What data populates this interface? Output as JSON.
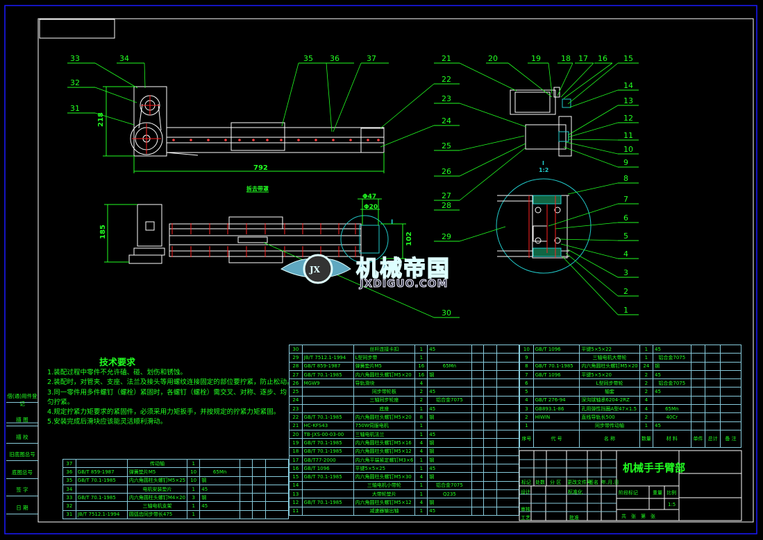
{
  "drawing_title": "机械手手臂部",
  "watermark": {
    "cn": "机械帝国",
    "en": "JXDIGUO.COM",
    "badge": "JX"
  },
  "view_label": "拆去带罩",
  "detail_label": {
    "name": "I",
    "scale": "1:2"
  },
  "dimensions": {
    "height_top": "218",
    "length": "792",
    "height_side": "185",
    "detail_height": "102",
    "dia_outer": "Φ47",
    "dia_inner": "Φ20"
  },
  "balloons": [
    "1",
    "2",
    "3",
    "4",
    "5",
    "6",
    "7",
    "8",
    "9",
    "10",
    "11",
    "12",
    "13",
    "14",
    "15",
    "16",
    "17",
    "18",
    "19",
    "20",
    "21",
    "22",
    "23",
    "24",
    "25",
    "26",
    "27",
    "28",
    "29",
    "30",
    "31",
    "32",
    "33",
    "34",
    "35",
    "36",
    "37"
  ],
  "tech_requirements": {
    "title": "技术要求",
    "items": [
      "1.装配过程中零件不允许磕、碰、划伤和锈蚀。",
      "2.装配时，对管夹、支座、法兰及接头等用螺纹连接固定的部位要拧紧，防止松动。",
      "3.同一零件用多件螺钉（螺栓）紧固时，各螺钉（螺栓）需交叉、对称、逐步、均",
      "匀拧紧。",
      "4.规定拧紧力矩要求的紧固件，必须采用力矩扳手，并按规定的拧紧力矩紧固。",
      "5.安装完成后滑块应该能灵活顺利滑动。"
    ]
  },
  "side_strip": [
    "借(通)用件登记",
    "描 图",
    "描 校",
    "旧底图总号",
    "底图总号",
    "签 字",
    "日 期"
  ],
  "bom_header": {
    "no": "序号",
    "code": "代 号",
    "name": "名 称",
    "qty": "数量",
    "material": "材 料",
    "single": "单件",
    "total": "总计",
    "weight": "重 量",
    "remark": "备 注"
  },
  "bom_middle": [
    [
      "30",
      "",
      "丝杆连接卡扣",
      "1",
      "45"
    ],
    [
      "29",
      "JB/T 7512.1-1994",
      "L型同步带",
      "1",
      ""
    ],
    [
      "28",
      "GB/T 859-1987",
      "弹簧垫片M5",
      "16",
      "65Mn"
    ],
    [
      "27",
      "GB/T 70.1-1985",
      "内六角圆柱头螺钉M5×20",
      "16",
      "钢"
    ],
    [
      "26",
      "MGW9",
      "导轨滑块",
      "4",
      ""
    ],
    [
      "25",
      "",
      "同步带轮板",
      "2",
      "45"
    ],
    [
      "24",
      "",
      "三轴同步轮座",
      "2",
      "铝合金7075"
    ],
    [
      "23",
      "",
      "底座",
      "1",
      "45"
    ],
    [
      "22",
      "GB/T 70.1-1985",
      "内六角圆柱头螺钉M5×20",
      "8",
      "钢"
    ],
    [
      "21",
      "HC-KFS43",
      "750W伺服电机",
      "1",
      ""
    ],
    [
      "20",
      "TB-JXS-00-03-00",
      "三轴电机法兰",
      "1",
      "45"
    ],
    [
      "19",
      "GB/T 70.1-1985",
      "内六角圆柱头螺钉M5×16",
      "4",
      "钢"
    ],
    [
      "18",
      "GB/T 70.1-1985",
      "内六角圆柱头螺钉M5×12",
      "4",
      "钢"
    ],
    [
      "17",
      "GB/T77-2000",
      "内六角平端紧定螺钉M3×6",
      "1",
      "钢"
    ],
    [
      "16",
      "GB/T 1096",
      "平键5×5×25",
      "1",
      "45"
    ],
    [
      "15",
      "GB/T 70.1-1985",
      "内六角圆柱头螺钉M5×30",
      "4",
      "钢"
    ],
    [
      "14",
      "",
      "三轴电机小带轮",
      "1",
      "铝合金7075"
    ],
    [
      "13",
      "",
      "大带轮垫片",
      "1",
      "Q235"
    ],
    [
      "12",
      "GB/T 70.1-1985",
      "内六角圆柱头螺钉M5×12",
      "4",
      "钢"
    ],
    [
      "11",
      "",
      "减速器输出轴",
      "1",
      "45"
    ]
  ],
  "bom_right": [
    [
      "10",
      "GB/T 1096",
      "平键5×5×22",
      "1",
      "45"
    ],
    [
      "9",
      "",
      "三轴电机大带轮",
      "1",
      "铝合金7075"
    ],
    [
      "8",
      "GB/T 70.1-1985",
      "内六角圆柱头螺钉M5×20",
      "24",
      "钢"
    ],
    [
      "7",
      "GB/T 1096",
      "平键5×5×20",
      "2",
      "45"
    ],
    [
      "6",
      "",
      "L型同步带轮",
      "2",
      "铝合金7075"
    ],
    [
      "5",
      "",
      "轴套",
      "2",
      "45"
    ],
    [
      "4",
      "GB/T 276-94",
      "深沟球轴承6204-2RZ",
      "4",
      ""
    ],
    [
      "3",
      "GB893.1-86",
      "孔用弹性挡圈A型47×1.5",
      "4",
      "65Mn"
    ],
    [
      "2",
      "HIWIN",
      "直线导轨长500",
      "2",
      "40Cr"
    ],
    [
      "1",
      "",
      "同步带传动轴",
      "1",
      "45"
    ]
  ],
  "bom_left": [
    [
      "37",
      "",
      "传动轴",
      "1",
      ""
    ],
    [
      "36",
      "GB/T 859-1987",
      "弹簧垫片M5",
      "10",
      "65Mn"
    ],
    [
      "35",
      "GB/T 70.1-1985",
      "内六角圆柱头螺钉M5×25",
      "10",
      "钢"
    ],
    [
      "34",
      "",
      "电机安装垫片",
      "1",
      "45"
    ],
    [
      "33",
      "GB/T 70.1-1985",
      "内六角圆柱头螺钉M4×20",
      "3",
      "钢"
    ],
    [
      "32",
      "",
      "三轴电机支架",
      "1",
      "45"
    ],
    [
      "31",
      "JB/T 7512.1-1994",
      "圆弧齿同步带长475",
      "1",
      ""
    ]
  ],
  "title_block": {
    "revision_headers": [
      "标记",
      "处数",
      "分 区",
      "更改文件号",
      "签名",
      "年.月.日"
    ],
    "design": "设计",
    "standardization": "标准化",
    "review": "审核",
    "process": "工艺",
    "approve": "批准",
    "stage_mark": "阶段标记",
    "weight": "重量",
    "scale_label": "比例",
    "scale": "1:5",
    "sheets": "共　张　第　张"
  },
  "colors": {
    "background": "#000000",
    "outline": "#ffffff",
    "leader": "#22ff22",
    "center_line": "#ff2020",
    "detail": "#22cccc",
    "border": "#1a1aff"
  }
}
